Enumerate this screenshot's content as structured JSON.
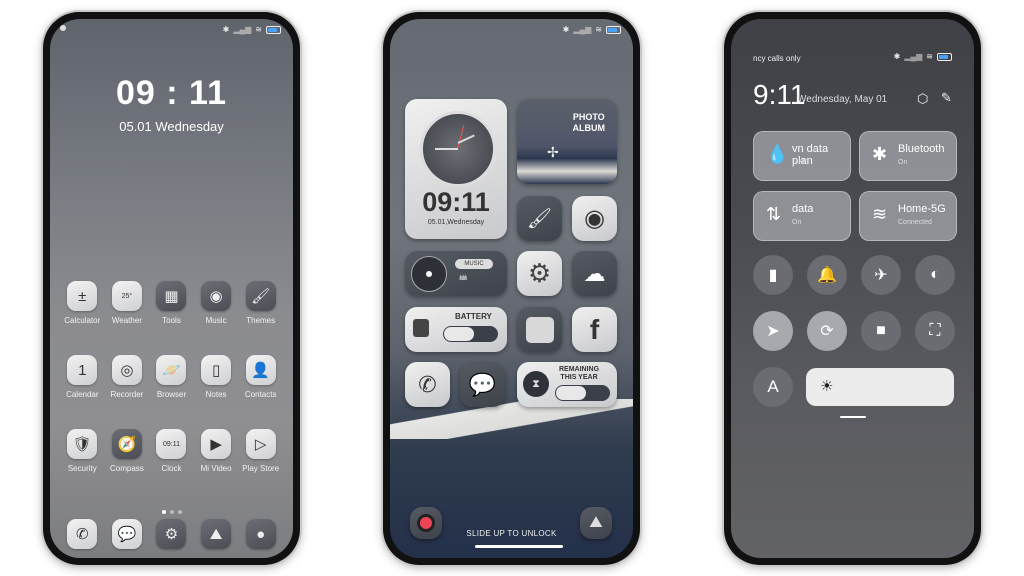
{
  "status_icons": [
    "bluetooth-icon",
    "signal-icon",
    "wifi-icon",
    "battery-icon"
  ],
  "phone1": {
    "clock": "09 : 11",
    "date": "05.01 Wednesday",
    "rows": [
      [
        {
          "label": "Calculator",
          "glyph": "±",
          "icon": "calculator-icon"
        },
        {
          "label": "Weather",
          "glyph": "25°",
          "icon": "weather-icon"
        },
        {
          "label": "Tools",
          "glyph": "▦",
          "icon": "tools-icon",
          "dark": true
        },
        {
          "label": "Music",
          "glyph": "◉",
          "icon": "music-icon",
          "dark": true
        },
        {
          "label": "Themes",
          "glyph": "🖌",
          "icon": "themes-icon",
          "dark": true
        }
      ],
      [
        {
          "label": "Calendar",
          "glyph": "1",
          "icon": "calendar-icon"
        },
        {
          "label": "Recorder",
          "glyph": "◎",
          "icon": "recorder-icon"
        },
        {
          "label": "Browser",
          "glyph": "🪐",
          "icon": "browser-icon"
        },
        {
          "label": "Notes",
          "glyph": "▯",
          "icon": "notes-icon"
        },
        {
          "label": "Contacts",
          "glyph": "👤",
          "icon": "contacts-icon"
        }
      ],
      [
        {
          "label": "Security",
          "glyph": "🛡",
          "icon": "security-icon"
        },
        {
          "label": "Compass",
          "glyph": "🧭",
          "icon": "compass-icon",
          "dark": true
        },
        {
          "label": "Clock",
          "glyph": "09:11",
          "icon": "clock-icon"
        },
        {
          "label": "Mi Video",
          "glyph": "▶",
          "icon": "mi-video-icon"
        },
        {
          "label": "Play Store",
          "glyph": "▷",
          "icon": "play-store-icon"
        }
      ]
    ],
    "page_indicator": {
      "pages": 3,
      "current": 1
    },
    "dock": [
      {
        "glyph": "✆",
        "icon": "phone-icon"
      },
      {
        "glyph": "💬",
        "icon": "messages-icon"
      },
      {
        "glyph": "⚙",
        "icon": "settings-icon",
        "dark": true
      },
      {
        "glyph": "⛰",
        "icon": "gallery-icon",
        "dark": true
      },
      {
        "glyph": "●",
        "icon": "camera-icon",
        "dark": true
      }
    ]
  },
  "phone2": {
    "clock_time": "09:11",
    "clock_date": "05.01,Wednesday",
    "photo_album": "PHOTO\nALBUM",
    "photo_album_l1": "PHOTO",
    "photo_album_l2": "ALBUM",
    "music_label": "MUSIC",
    "battery_label": "BATTERY",
    "remaining_l1": "REMAINING",
    "remaining_l2": "THIS YEAR",
    "unlock_text": "SLIDE UP TO UNLOCK"
  },
  "phone3": {
    "carrier": "ncy calls only",
    "time": "9:11",
    "date": "Wednesday, May 01",
    "tiles": [
      {
        "title": "vn data plan",
        "sub": "-- MB",
        "icon": "drop-icon",
        "glyph": "💧"
      },
      {
        "title": "Bluetooth",
        "sub": "On",
        "icon": "bluetooth-icon",
        "glyph": "✱"
      },
      {
        "title": "data",
        "sub": "On",
        "icon": "mobile-data-icon",
        "glyph": "⇅"
      },
      {
        "title": "Home-5G",
        "sub": "Connected",
        "icon": "wifi-icon",
        "glyph": "≋"
      }
    ],
    "toggles": [
      {
        "icon": "flashlight-icon",
        "glyph": "▮",
        "on": false
      },
      {
        "icon": "bell-icon",
        "glyph": "🔔",
        "on": false
      },
      {
        "icon": "airplane-icon",
        "glyph": "✈",
        "on": false
      },
      {
        "icon": "reading-mode-icon",
        "glyph": "◐",
        "on": false
      },
      {
        "icon": "location-icon",
        "glyph": "➤",
        "on": true
      },
      {
        "icon": "rotation-lock-icon",
        "glyph": "⟳",
        "on": true
      },
      {
        "icon": "video-icon",
        "glyph": "■",
        "on": false
      },
      {
        "icon": "scan-icon",
        "glyph": "⛶",
        "on": false
      }
    ],
    "auto_brightness": "A",
    "brightness_icon": "☀"
  }
}
